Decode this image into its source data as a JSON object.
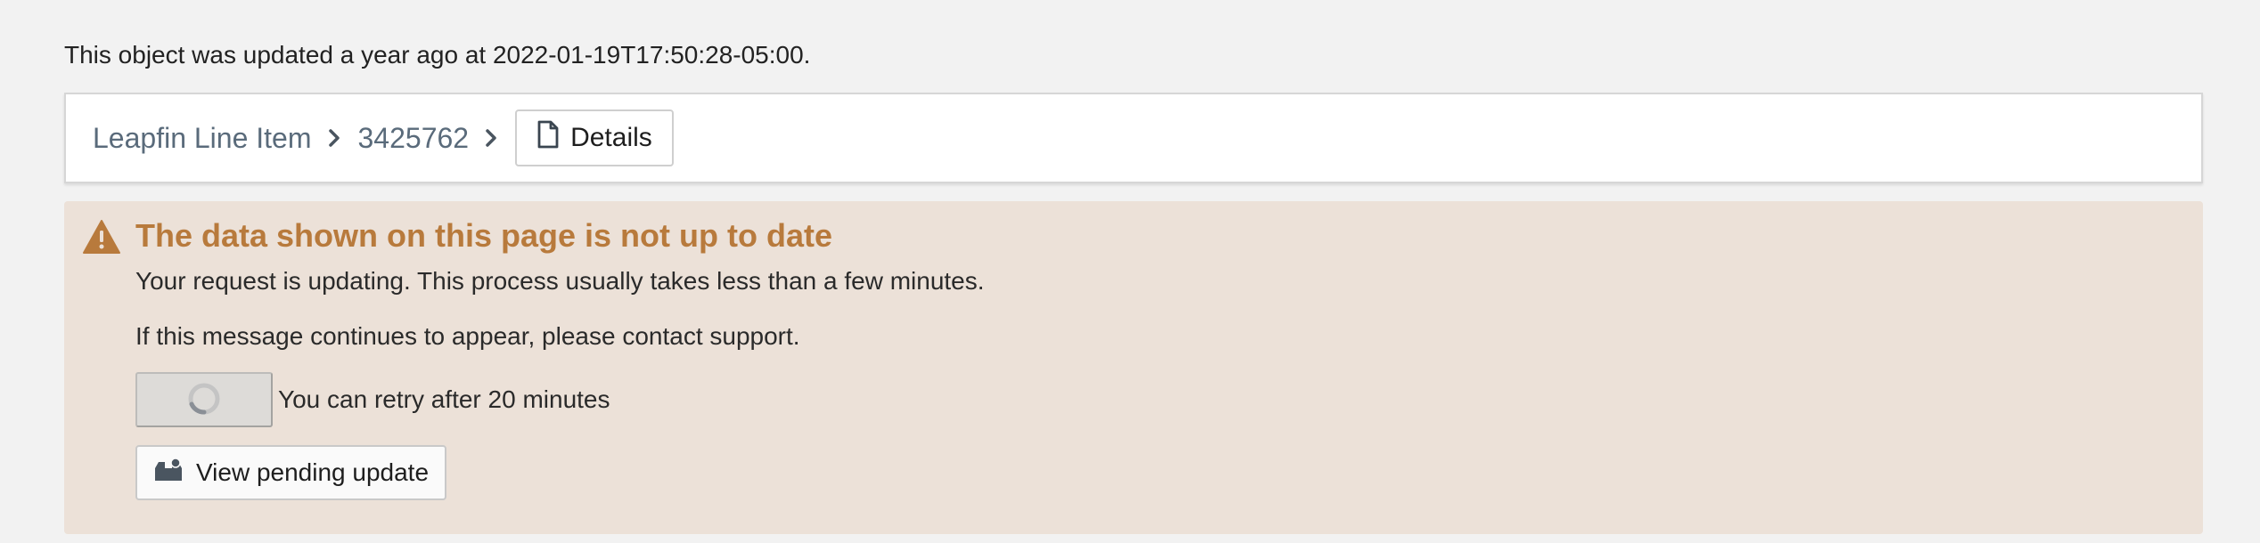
{
  "meta": {
    "updated_text": "This object was updated a year ago at 2022-01-19T17:50:28-05:00."
  },
  "breadcrumb": {
    "items": [
      {
        "label": "Leapfin Line Item"
      },
      {
        "label": "3425762"
      }
    ],
    "current": {
      "label": "Details",
      "icon": "file-icon"
    }
  },
  "alert": {
    "icon": "warning-triangle-icon",
    "title": "The data shown on this page is not up to date",
    "message_1": "Your request is updating. This process usually takes less than a few minutes.",
    "message_2": "If this message continues to appear, please contact support.",
    "retry": {
      "icon": "spinner-icon",
      "label": "You can retry after 20 minutes"
    },
    "pending_button": {
      "icon": "inbox-icon",
      "label": "View pending update"
    },
    "accent_color": "#b87a3c",
    "background_color": "#ece1d8"
  }
}
